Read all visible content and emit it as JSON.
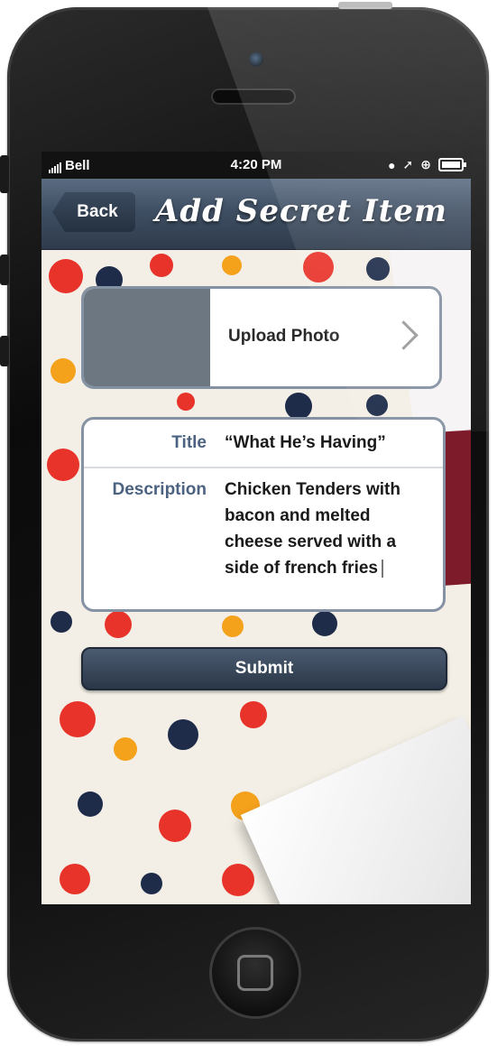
{
  "status_bar": {
    "carrier": "Bell",
    "time": "4:20 PM",
    "icons": [
      "lock-rotation-icon",
      "location-arrow-icon",
      "alarm-icon",
      "battery-icon"
    ]
  },
  "nav": {
    "back_label": "Back",
    "title": "Add Secret Item"
  },
  "upload": {
    "label": "Upload Photo"
  },
  "form": {
    "title_label": "Title",
    "title_value": "“What He’s Having”",
    "description_label": "Description",
    "description_value": "Chicken Tenders with bacon and melted cheese served with a side of french fries"
  },
  "submit_label": "Submit",
  "colors": {
    "nav_bar": "#3f4f63",
    "label_blue": "#4b6280",
    "card_border": "#8592a3",
    "photo_placeholder": "#6d7782",
    "button": "#2a3748"
  }
}
